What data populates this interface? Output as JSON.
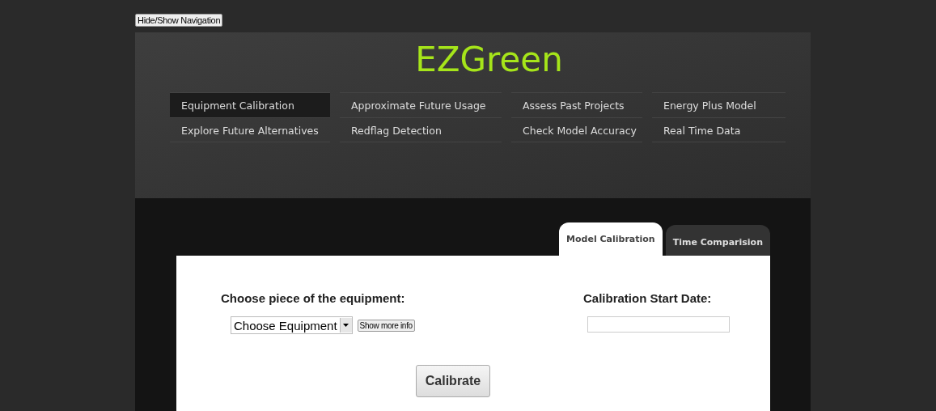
{
  "toggle_button": "Hide/Show Navigation",
  "title": "EZGreen",
  "nav": [
    {
      "label": "Equipment Calibration",
      "selected": true
    },
    {
      "label": "Approximate Future Usage",
      "selected": false
    },
    {
      "label": "Assess Past Projects",
      "selected": false
    },
    {
      "label": "Energy Plus Model",
      "selected": false
    },
    {
      "label": "Explore Future Alternatives",
      "selected": false
    },
    {
      "label": "Redflag Detection",
      "selected": false
    },
    {
      "label": "Check Model Accuracy",
      "selected": false
    },
    {
      "label": "Real Time Data",
      "selected": false
    }
  ],
  "tabs": [
    {
      "label": "Model Calibration",
      "selected": true
    },
    {
      "label": "Time Comparision",
      "selected": false
    }
  ],
  "form": {
    "equipment_label": "Choose piece of the equipment:",
    "equipment_select": "Choose Equipment",
    "more_info_button": "Show more info",
    "date_label": "Calibration Start Date:",
    "calibrate_button": "Calibrate"
  }
}
